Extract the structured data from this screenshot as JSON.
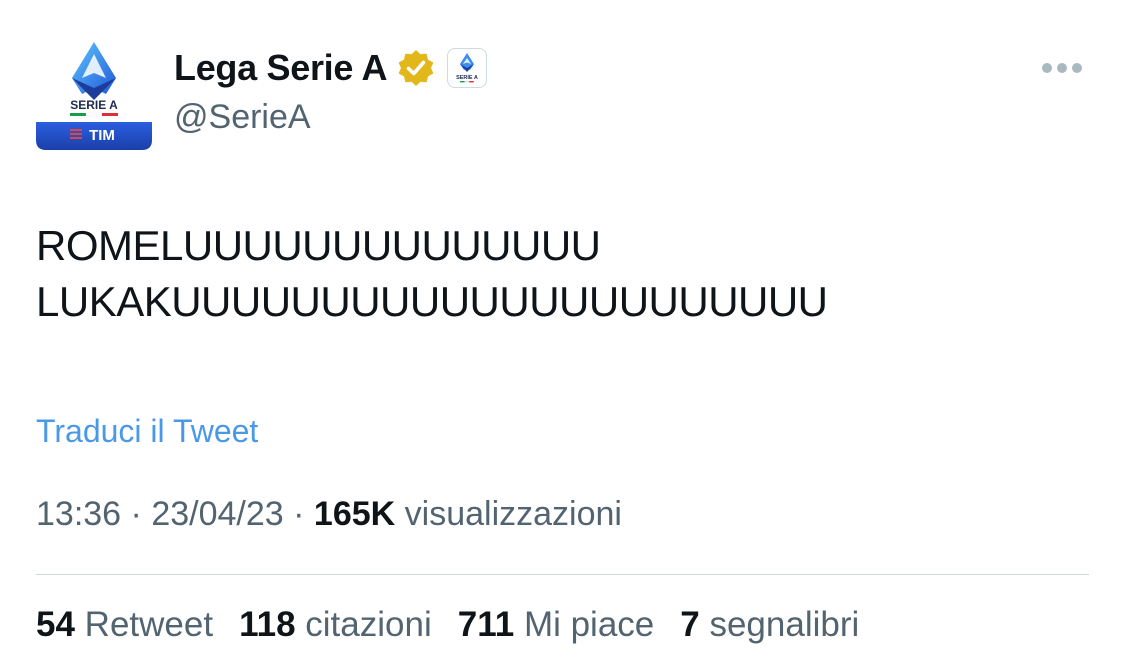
{
  "author": {
    "display_name": "Lega Serie A",
    "handle": "@SerieA",
    "avatar_icon": "serie-a-tim-logo",
    "avatar_text_top": "SERIE A",
    "avatar_text_bottom": "TIM",
    "verified_icon": "gold-verified-checkmark-icon",
    "affiliate_icon": "serie-a-affiliate-badge",
    "affiliate_text": "SERIE A",
    "more_icon": "more-options-icon"
  },
  "tweet": {
    "line1": "ROMELUUUUUUUUUUUUUU",
    "line2": "LUKAKUUUUUUUUUUUUUUUUUUUUUU"
  },
  "translate_link": "Traduci il Tweet",
  "meta": {
    "time": "13:36",
    "separator": "·",
    "date": "23/04/23",
    "views_count": "165K",
    "views_label": "visualizzazioni"
  },
  "stats": [
    {
      "count": "54",
      "label": "Retweet"
    },
    {
      "count": "118",
      "label": "citazioni"
    },
    {
      "count": "711",
      "label": "Mi piace"
    },
    {
      "count": "7",
      "label": "segnalibri"
    }
  ],
  "colors": {
    "link": "#4a99e9",
    "secondary_text": "#536471",
    "primary_text": "#0f1419",
    "brand_blue": "#1b47c4",
    "verified_gold": "#e2b719"
  }
}
